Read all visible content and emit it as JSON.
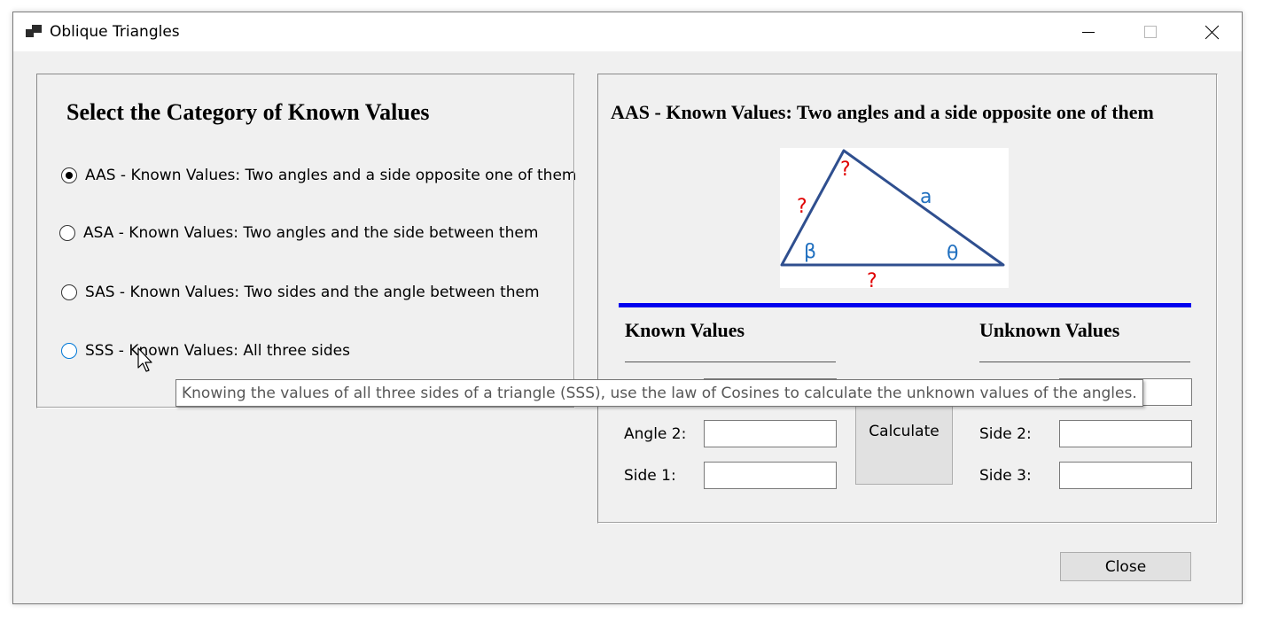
{
  "window": {
    "title": "Oblique Triangles",
    "icon": "app-window-icon",
    "controls": [
      "minimize-icon",
      "maximize-icon",
      "close-icon"
    ]
  },
  "left_panel": {
    "heading": "Select the Category of Known Values",
    "options": [
      {
        "label": "AAS - Known Values: Two angles and a side opposite one of them",
        "checked": true
      },
      {
        "label": "ASA - Known Values: Two angles and the side between them",
        "checked": false
      },
      {
        "label": "SAS - Known Values: Two sides and the angle between them",
        "checked": false
      },
      {
        "label": "SSS - Known Values: All three sides",
        "checked": false
      }
    ]
  },
  "right_panel": {
    "heading": "AAS - Known Values: Two angles and a side opposite one of them",
    "diagram": {
      "unknown_marker": "?",
      "side_label": "a",
      "angle_left": "β",
      "angle_right": "θ"
    },
    "known_heading": "Known Values",
    "unknown_heading": "Unknown Values",
    "known_fields": [
      {
        "label": "Angle 2:",
        "value": ""
      },
      {
        "label": "Side 1:",
        "value": ""
      }
    ],
    "unknown_fields": [
      {
        "label": "",
        "value": ""
      },
      {
        "label": "Side 2:",
        "value": ""
      },
      {
        "label": "Side 3:",
        "value": ""
      }
    ],
    "calculate_label": "Calculate"
  },
  "tooltip": "Knowing the values of all three sides of a triangle (SSS), use the law of Cosines to calculate the unknown values of the angles.",
  "close_label": "Close",
  "colors": {
    "accent_rule": "#0000ee",
    "diagram_lines": "#2f4f8f",
    "unknown_marker": "#e00000",
    "diagram_labels": "#1f6fbf"
  }
}
